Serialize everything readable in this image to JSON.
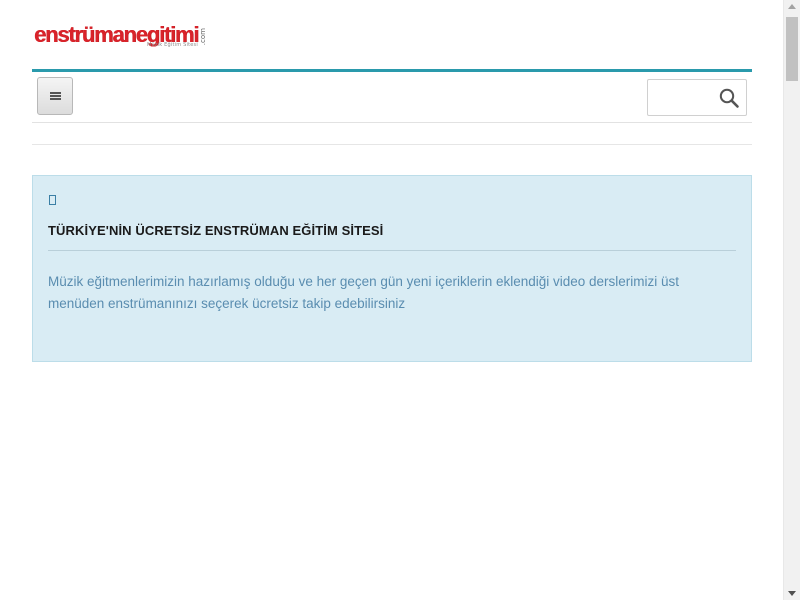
{
  "header": {
    "logo": {
      "wordmark": "enstrümanegitimi",
      "suffix": ".com",
      "tagline": "Müzik Eğitim Sitesi",
      "brand_color": "#d9232a"
    }
  },
  "navbar": {
    "accent_color": "#2a9aac",
    "menu_button_icon": "hamburger-icon",
    "search": {
      "value": "",
      "placeholder": "",
      "icon": "search-icon"
    }
  },
  "info_panel": {
    "icon": "info-icon",
    "title": "TÜRKİYE'NİN ÜCRETSİZ ENSTRÜMAN EĞİTİM SİTESİ",
    "text": "Müzik eğitmenlerimizin hazırlamış olduğu ve her geçen gün yeni içeriklerin eklendiği video derslerimizi üst menüden enstrümanınızı seçerek ücretsiz takip edebilirsiniz",
    "background_color": "#d9ecf4",
    "text_color": "#5a8db0"
  }
}
